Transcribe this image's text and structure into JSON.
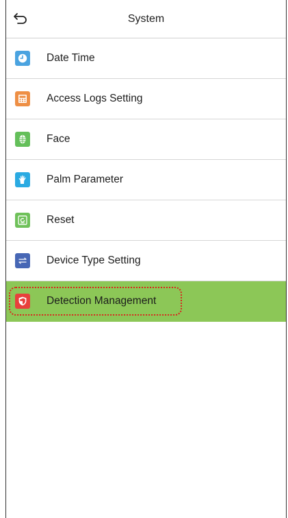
{
  "header": {
    "title": "System",
    "back_icon": "back-arrow-icon"
  },
  "menu": {
    "items": [
      {
        "label": "Date Time",
        "icon": "clock-icon",
        "color": "#4aa3e0"
      },
      {
        "label": "Access Logs Setting",
        "icon": "logs-icon",
        "color": "#ee8f45"
      },
      {
        "label": "Face",
        "icon": "face-icon",
        "color": "#64bf5a"
      },
      {
        "label": "Palm Parameter",
        "icon": "palm-icon",
        "color": "#2aaae2"
      },
      {
        "label": "Reset",
        "icon": "reset-icon",
        "color": "#6fc15a"
      },
      {
        "label": "Device Type Setting",
        "icon": "swap-arrows-icon",
        "color": "#4767b5"
      },
      {
        "label": "Detection Management",
        "icon": "shield-icon",
        "color": "#e8413c",
        "selected": true
      }
    ]
  },
  "colors": {
    "selected_background": "#8cc757",
    "highlight_outline": "#d9251c"
  }
}
